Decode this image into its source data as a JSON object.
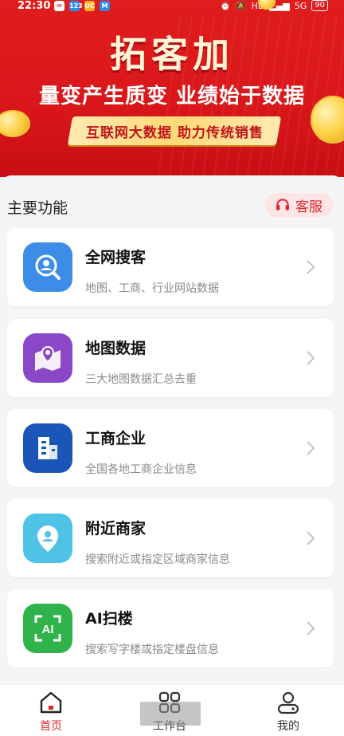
{
  "status": {
    "time": "22:30",
    "apps": [
      "123",
      "UC",
      "M"
    ],
    "right_text": "HD",
    "signal": "5G",
    "battery": "90"
  },
  "banner": {
    "title": "拓客加",
    "slogan": "量变产生质变 业绩始于数据",
    "ribbon": "互联网大数据 助力传统销售"
  },
  "section": {
    "title": "主要功能",
    "service_label": "客服"
  },
  "features": [
    {
      "title": "全网搜客",
      "desc": "地图、工商、行业网站数据",
      "icon": "search-user-icon",
      "color": "#3d8de8"
    },
    {
      "title": "地图数据",
      "desc": "三大地图数据汇总去重",
      "icon": "map-pin-icon",
      "color": "#8a48c8"
    },
    {
      "title": "工商企业",
      "desc": "全国各地工商企业信息",
      "icon": "building-icon",
      "color": "#1a56b8"
    },
    {
      "title": "附近商家",
      "desc": "搜索附近或指定区域商家信息",
      "icon": "location-icon",
      "color": "#4fc3e6"
    },
    {
      "title": "AI扫楼",
      "desc": "搜索写字楼或指定楼盘信息",
      "icon": "ai-scan-icon",
      "color": "#2fb34a"
    }
  ],
  "tabs": [
    {
      "label": "首页",
      "icon": "home-icon",
      "active": true
    },
    {
      "label": "工作台",
      "icon": "workbench-icon",
      "active": false
    },
    {
      "label": "我的",
      "icon": "profile-icon",
      "active": false
    }
  ],
  "colors": {
    "brand_red": "#d9161a",
    "accent": "#e0262a"
  }
}
